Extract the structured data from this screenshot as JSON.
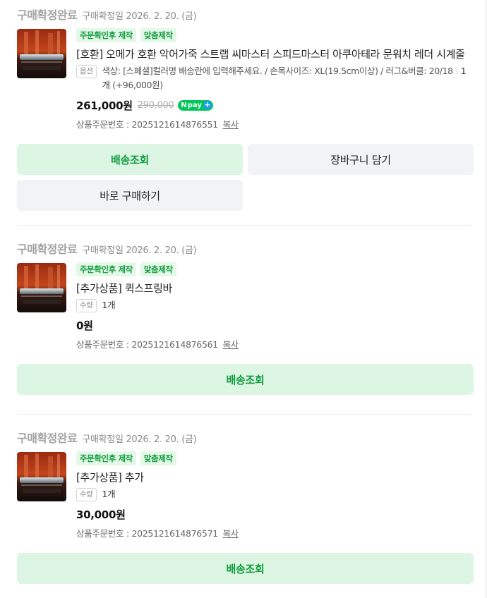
{
  "orders": [
    {
      "status": "구매확정완료",
      "confirm_date": "구매확정일 2026. 2. 20. (금)",
      "badges": [
        "주문확인후 제작",
        "맞춤제작"
      ],
      "title": "[호환] 오메가 호환 악어가죽 스트랩 씨마스터 스피드마스터 아쿠아테라 문워치 레더 시계줄",
      "option_tag": "옵션",
      "option_text": "색상: [스페셜]컬러명 배송란에 입력해주세요. / 손목사이즈: XL(19.5cm이상) / 러그&버클: 20/18",
      "quantity": "1개",
      "extra_price": "(+96,000원)",
      "price": "261,000원",
      "original_price": "290,000",
      "npay_label": "pay",
      "order_number_label": "상품주문번호 : 2025121614876551",
      "copy_label": "복사",
      "buttons": {
        "track": "배송조회",
        "cart": "장바구니 담기",
        "buy_now": "바로 구매하기"
      }
    },
    {
      "status": "구매확정완료",
      "confirm_date": "구매확정일 2026. 2. 20. (금)",
      "badges": [
        "주문확인후 제작",
        "맞춤제작"
      ],
      "title": "[추가상품] 퀵스프링바",
      "quantity_tag": "수량",
      "quantity": "1개",
      "price": "0원",
      "order_number_label": "상품주문번호 : 2025121614876561",
      "copy_label": "복사",
      "buttons": {
        "track": "배송조회"
      }
    },
    {
      "status": "구매확정완료",
      "confirm_date": "구매확정일 2026. 2. 20. (금)",
      "badges": [
        "주문확인후 제작",
        "맞춤제작"
      ],
      "title": "[추가상품] 추가",
      "quantity_tag": "수량",
      "quantity": "1개",
      "price": "30,000원",
      "order_number_label": "상품주문번호 : 2025121614876571",
      "copy_label": "복사",
      "buttons": {
        "track": "배송조회"
      }
    }
  ],
  "colors": {
    "badge_text": "#129c3f",
    "badge_bg": "#e3f8e7",
    "track_button_bg": "#ddf6e3",
    "secondary_button_bg": "#f2f3f5",
    "status_text": "#a3a3a3",
    "npay_green": "#03c75a"
  },
  "icons": {
    "product_thumbnail": "watch-strap-product-image",
    "npay": "npay-plus-icon"
  }
}
